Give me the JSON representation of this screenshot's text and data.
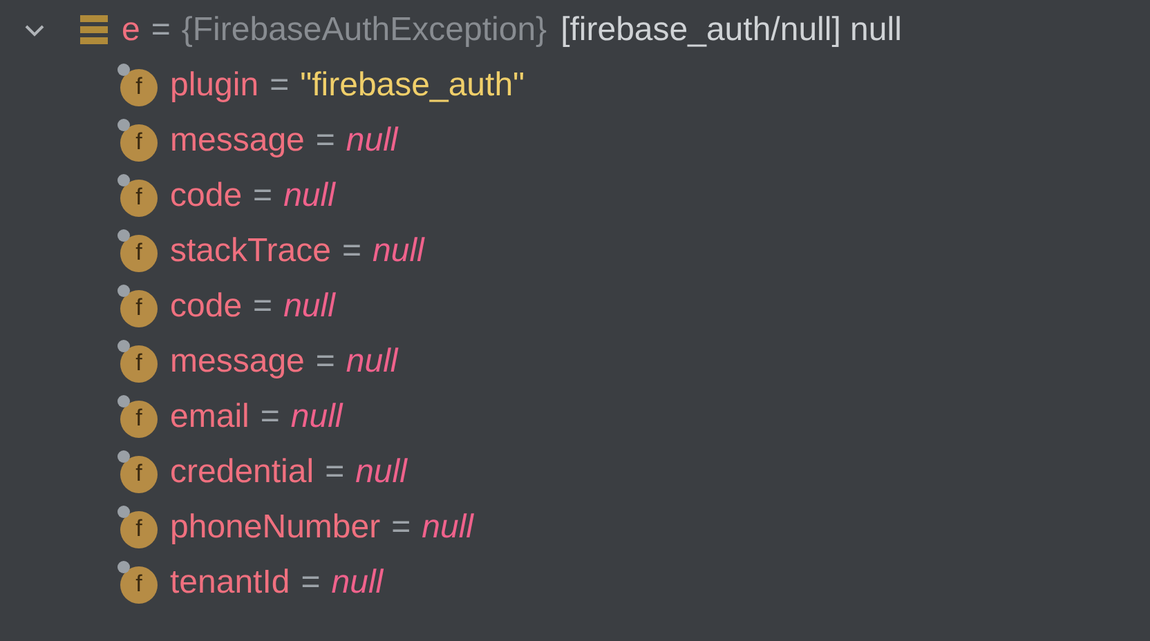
{
  "variables": {
    "expanded": true,
    "name": "e",
    "separator": "=",
    "type": "{FirebaseAuthException}",
    "value": "[firebase_auth/null] null",
    "children": [
      {
        "badge": "f",
        "name": "plugin",
        "separator": "=",
        "value": "\"firebase_auth\"",
        "kind": "string"
      },
      {
        "badge": "f",
        "name": "message",
        "separator": "=",
        "value": "null",
        "kind": "null"
      },
      {
        "badge": "f",
        "name": "code",
        "separator": "=",
        "value": "null",
        "kind": "null"
      },
      {
        "badge": "f",
        "name": "stackTrace",
        "separator": "=",
        "value": "null",
        "kind": "null"
      },
      {
        "badge": "f",
        "name": "code",
        "separator": "=",
        "value": "null",
        "kind": "null"
      },
      {
        "badge": "f",
        "name": "message",
        "separator": "=",
        "value": "null",
        "kind": "null"
      },
      {
        "badge": "f",
        "name": "email",
        "separator": "=",
        "value": "null",
        "kind": "null"
      },
      {
        "badge": "f",
        "name": "credential",
        "separator": "=",
        "value": "null",
        "kind": "null"
      },
      {
        "badge": "f",
        "name": "phoneNumber",
        "separator": "=",
        "value": "null",
        "kind": "null"
      },
      {
        "badge": "f",
        "name": "tenantId",
        "separator": "=",
        "value": "null",
        "kind": "null"
      }
    ]
  }
}
